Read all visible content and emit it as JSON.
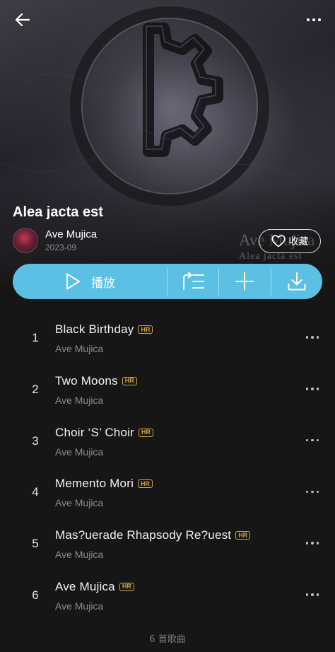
{
  "header": {
    "back_icon": "arrow-left-icon",
    "more_icon": "more-dots-icon"
  },
  "album": {
    "title": "Alea jacta est",
    "artist": "Ave Mujica",
    "release_date": "2023-09",
    "cover_watermark_line1": "Ave Mujica",
    "cover_watermark_line2": "Alea jacta est"
  },
  "favorite": {
    "label": "收藏",
    "icon": "heart-outline-icon"
  },
  "action_bar": {
    "play_label": "播放",
    "play_icon": "play-icon",
    "queue_icon": "add-to-queue-icon",
    "add_icon": "plus-icon",
    "download_icon": "download-icon",
    "color": "#5bc0e4"
  },
  "tracks": [
    {
      "index": "1",
      "title": "Black Birthday",
      "badge": "HR",
      "artist": "Ave Mujica"
    },
    {
      "index": "2",
      "title": "Two Moons",
      "badge": "HR",
      "artist": "Ave Mujica"
    },
    {
      "index": "3",
      "title": "Choir ‘S’ Choir",
      "badge": "HR",
      "artist": "Ave Mujica"
    },
    {
      "index": "4",
      "title": "Memento Mori",
      "badge": "HR",
      "artist": "Ave Mujica"
    },
    {
      "index": "5",
      "title": "Mas?uerade Rhapsody Re?uest",
      "badge": "HR",
      "artist": "Ave Mujica"
    },
    {
      "index": "6",
      "title": "Ave Mujica",
      "badge": "HR",
      "artist": "Ave Mujica"
    }
  ],
  "footer": {
    "count_text": "6 首歌曲"
  },
  "colors": {
    "background": "#161616",
    "accent": "#5bc0e4",
    "hr_badge": "#d4a63c"
  }
}
